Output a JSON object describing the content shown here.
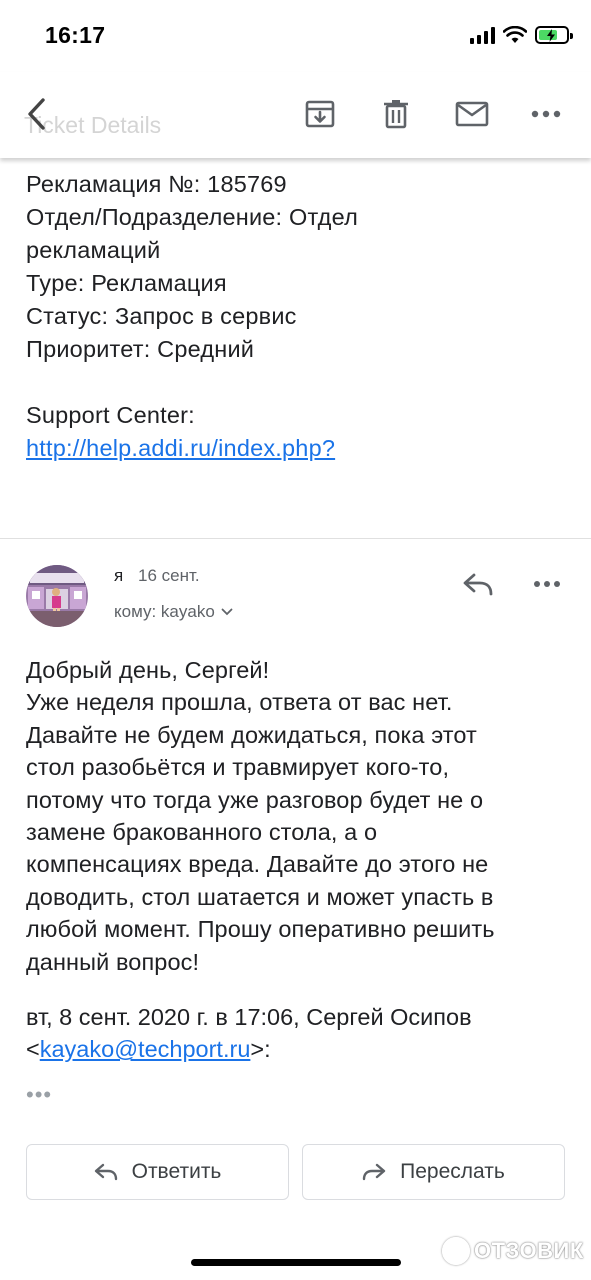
{
  "status_bar": {
    "time": "16:17",
    "battery_level": 0.7
  },
  "toolbar": {
    "ghost_title": "Ticket Details"
  },
  "ticket": {
    "lines": [
      "Рекламация №: 185769",
      "Отдел/Подразделение: Отдел",
      "рекламаций",
      "Type: Рекламация",
      "Статус: Запрос в сервис",
      "Приоритет: Средний"
    ],
    "support_label": "Support Center:",
    "support_link": "http://help.addi.ru/index.php?"
  },
  "message": {
    "sender": "я",
    "date": "16 сент.",
    "recipient": "кому: kayako",
    "body": [
      "Добрый день, Сергей!",
      "Уже неделя прошла, ответа от вас нет.",
      "Давайте не будем дожидаться, пока этот",
      "стол разобьётся и травмирует кого-то,",
      "потому что тогда уже разговор будет не о",
      "замене бракованного стола, а о",
      "компенсациях вреда. Давайте до этого не",
      "доводить, стол шатается и может упасть в",
      "любой момент. Прошу оперативно решить",
      "данный вопрос!"
    ],
    "quote_line1": "вт, 8 сент. 2020 г. в 17:06, Сергей Осипов",
    "quote_open": "<",
    "quote_email": "kayako@techport.ru",
    "quote_close": ">:",
    "expand": "•••"
  },
  "actions": {
    "reply_label": "Ответить",
    "forward_label": "Переслать"
  },
  "watermark": {
    "text": "ОТЗОВИК"
  },
  "colors": {
    "link": "#1a73e8",
    "battery": "#4cd964",
    "text": "#202124",
    "secondary": "#5f6368"
  }
}
